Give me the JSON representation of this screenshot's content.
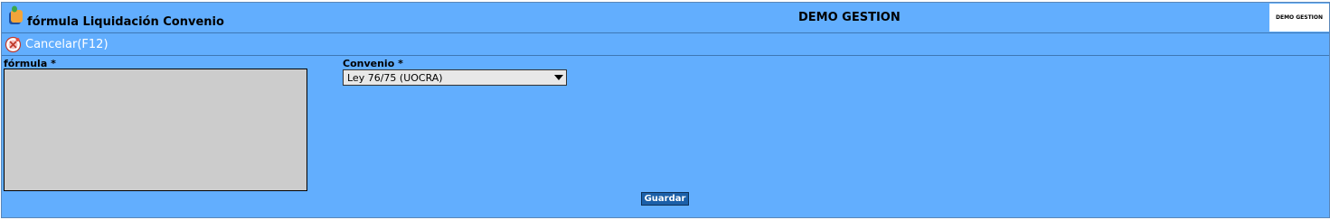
{
  "header": {
    "form_title": "fórmula Liquidación Convenio",
    "company_name": "DEMO GESTION",
    "logo_text": "DEMO GESTION",
    "app_icon": "app-logo-icon"
  },
  "toolbar": {
    "cancel_label": "Cancelar(F12)",
    "cancel_icon": "cancel-icon"
  },
  "form": {
    "formula_label": "fórmula *",
    "formula_value": "",
    "convenio_label": "Convenio *",
    "convenio_selected": "Ley 76/75 (UOCRA)",
    "save_label": "Guardar"
  },
  "colors": {
    "background": "#62aefe",
    "textarea_bg": "#cccccc",
    "button_bg": "#1b5fa8"
  }
}
